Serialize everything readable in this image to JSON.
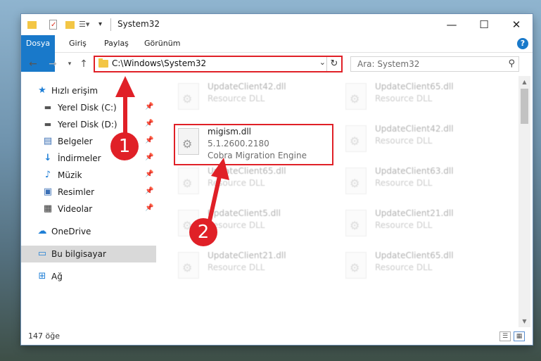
{
  "window": {
    "title": "System32",
    "controls": {
      "minimize": "—",
      "maximize": "☐",
      "close": "✕"
    }
  },
  "ribbon": {
    "tabs": [
      "Dosya",
      "Giriş",
      "Paylaş",
      "Görünüm"
    ],
    "help": "?"
  },
  "navigation": {
    "address": "C:\\Windows\\System32",
    "search_placeholder": "Ara: System32"
  },
  "sidebar": {
    "items": [
      {
        "label": "Hızlı erişim",
        "icon": "star-icon",
        "pinned": false
      },
      {
        "label": "Yerel Disk (C:)",
        "icon": "drive-icon",
        "pinned": true
      },
      {
        "label": "Yerel Disk (D:)",
        "icon": "drive-icon",
        "pinned": true
      },
      {
        "label": "Belgeler",
        "icon": "documents-icon",
        "pinned": true
      },
      {
        "label": "İndirmeler",
        "icon": "downloads-icon",
        "pinned": true
      },
      {
        "label": "Müzik",
        "icon": "music-icon",
        "pinned": true
      },
      {
        "label": "Resimler",
        "icon": "pictures-icon",
        "pinned": true
      },
      {
        "label": "Videolar",
        "icon": "videos-icon",
        "pinned": true
      },
      {
        "label": "OneDrive",
        "icon": "cloud-icon",
        "pinned": false
      },
      {
        "label": "Bu bilgisayar",
        "icon": "computer-icon",
        "pinned": false,
        "selected": true
      },
      {
        "label": "Ağ",
        "icon": "network-icon",
        "pinned": false
      }
    ]
  },
  "files": {
    "left_column": [
      {
        "name": "UpdateClient42.dll",
        "desc": "Resource DLL"
      },
      {
        "name": "migism.dll",
        "desc": "5.1.2600.2180",
        "extra": "Cobra Migration Engine"
      },
      {
        "name": "UpdateClient65.dll",
        "desc": "Resource DLL"
      },
      {
        "name": "UpdateClient5.dll",
        "desc": "Resource DLL"
      },
      {
        "name": "UpdateClient21.dll",
        "desc": "Resource DLL"
      }
    ],
    "right_column": [
      {
        "name": "UpdateClient65.dll",
        "desc": "Resource DLL"
      },
      {
        "name": "UpdateClient42.dll",
        "desc": "Resource DLL"
      },
      {
        "name": "UpdateClient63.dll",
        "desc": "Resource DLL"
      },
      {
        "name": "UpdateClient21.dll",
        "desc": "Resource DLL"
      },
      {
        "name": "UpdateClient65.dll",
        "desc": "Resource DLL"
      }
    ]
  },
  "status": {
    "item_count": "147 öğe"
  },
  "annotations": {
    "step1": "1",
    "step2": "2",
    "color": "#e02027"
  }
}
